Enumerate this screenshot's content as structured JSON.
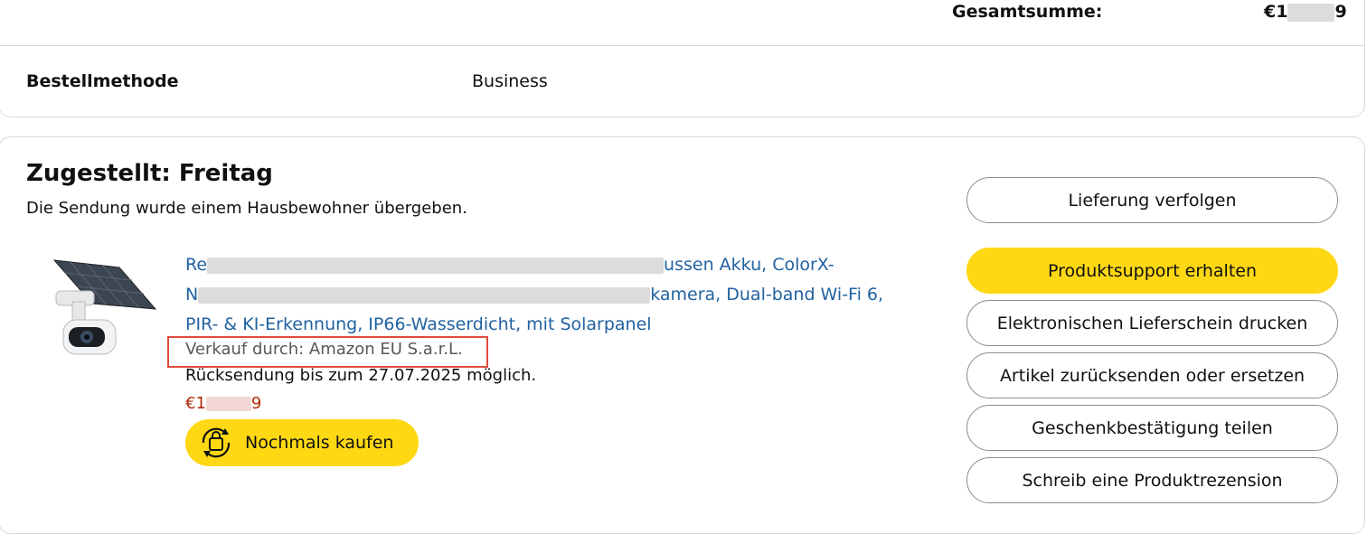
{
  "summary": {
    "total_label": "Gesamtsumme:",
    "total_value_prefix": "€1",
    "total_value_suffix": "9"
  },
  "order": {
    "method_label": "Bestellmethode",
    "method_value": "Business"
  },
  "delivery": {
    "title": "Zugestellt: Freitag",
    "subtitle": "Die Sendung wurde einem Hausbewohner übergeben."
  },
  "product": {
    "title_line1_prefix": "Re",
    "title_line1_suffix": "ussen Akku, ColorX-",
    "title_line2_prefix": "N",
    "title_line2_suffix": "kamera, Dual-band Wi-Fi 6,",
    "title_line3": "PIR- & KI-Erkennung, IP66-Wasserdicht, mit Solarpanel",
    "seller": "Verkauf durch: Amazon EU S.a.r.L.",
    "return_info": "Rücksendung bis zum 27.07.2025 möglich.",
    "price_prefix": "€1",
    "price_suffix": "9",
    "buy_again_label": "Nochmals kaufen",
    "image_icon": "solar-camera-image"
  },
  "actions": {
    "track": "Lieferung verfolgen",
    "support": "Produktsupport erhalten",
    "delivery_note": "Elektronischen Lieferschein drucken",
    "return": "Artikel zurücksenden oder ersetzen",
    "gift": "Geschenkbestätigung teilen",
    "review": "Schreib eine Produktrezension"
  },
  "colors": {
    "accent_yellow": "#ffd814",
    "link_blue": "#2162a1",
    "price_red": "#b12704",
    "highlight_red": "#e04a3f"
  }
}
